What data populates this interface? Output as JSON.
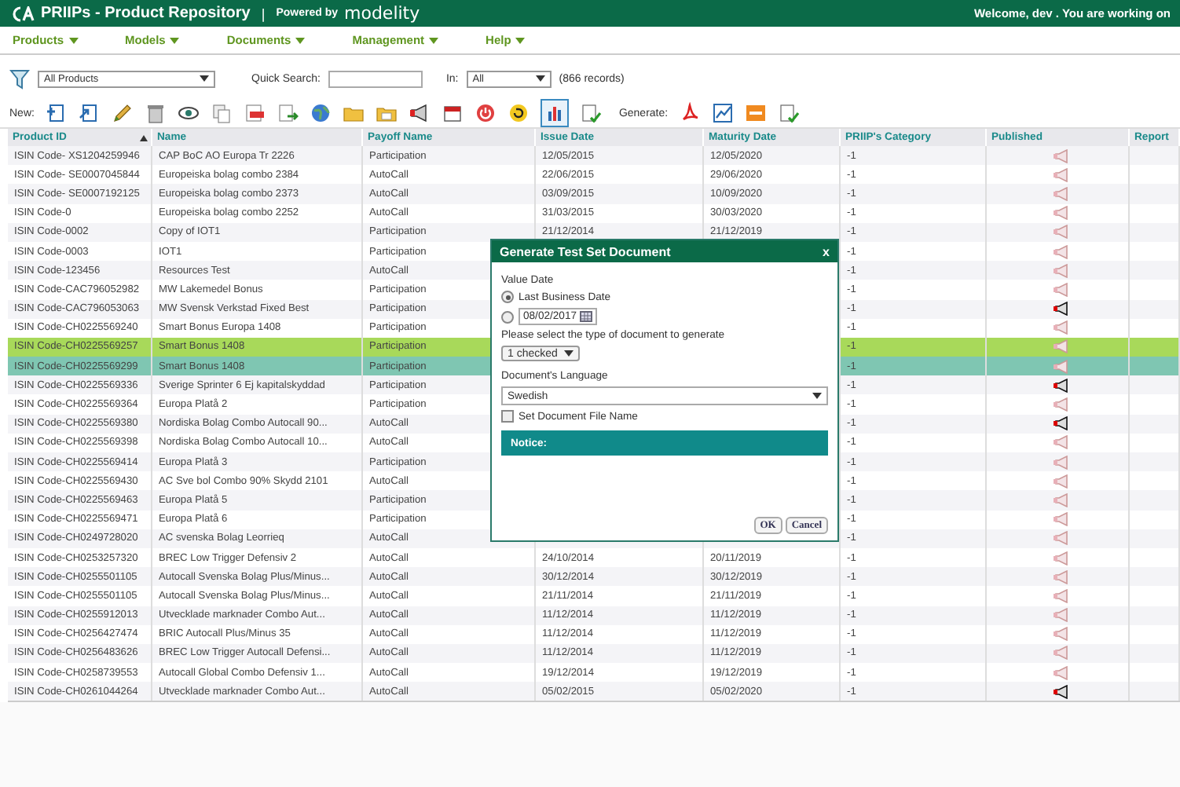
{
  "header": {
    "title": "PRIIPs - Product Repository",
    "separator": "|",
    "powered_by": "Powered by",
    "brand": "modelity",
    "welcome": "Welcome, dev . You are working on"
  },
  "menu": [
    {
      "label": "Products"
    },
    {
      "label": "Models"
    },
    {
      "label": "Documents"
    },
    {
      "label": "Management"
    },
    {
      "label": "Help"
    }
  ],
  "filter": {
    "view": "All Products",
    "quick_search_label": "Quick Search:",
    "in_label": "In:",
    "in_value": "All",
    "records": "(866 records)"
  },
  "toolbar": {
    "new_label": "New:",
    "generate_label": "Generate:",
    "chart_view_selected": true
  },
  "table": {
    "columns": [
      {
        "label": "Product ID",
        "sorted": true
      },
      {
        "label": "Name"
      },
      {
        "label": "Payoff Name"
      },
      {
        "label": "Issue Date"
      },
      {
        "label": "Maturity Date"
      },
      {
        "label": "PRIIP's Category"
      },
      {
        "label": "Published"
      },
      {
        "label": "Report"
      }
    ],
    "rows": [
      {
        "id": "ISIN Code- XS1204259946",
        "name": "CAP BoC AO Europa Tr 2226",
        "payoff": "Participation",
        "issue": "12/05/2015",
        "maturity": "12/05/2020",
        "category": "-1",
        "published": false,
        "selected": false,
        "highlighted": false
      },
      {
        "id": "ISIN Code- SE0007045844",
        "name": "Europeiska bolag combo 2384",
        "payoff": "AutoCall",
        "issue": "22/06/2015",
        "maturity": "29/06/2020",
        "category": "-1",
        "published": false,
        "selected": false,
        "highlighted": false
      },
      {
        "id": "ISIN Code- SE0007192125",
        "name": "Europeiska bolag combo 2373",
        "payoff": "AutoCall",
        "issue": "03/09/2015",
        "maturity": "10/09/2020",
        "category": "-1",
        "published": false,
        "selected": false,
        "highlighted": false
      },
      {
        "id": "ISIN Code-0",
        "name": "Europeiska bolag combo 2252",
        "payoff": "AutoCall",
        "issue": "31/03/2015",
        "maturity": "30/03/2020",
        "category": "-1",
        "published": false,
        "selected": false,
        "highlighted": false
      },
      {
        "id": "ISIN Code-0002",
        "name": "Copy of IOT1",
        "payoff": "Participation",
        "issue": "21/12/2014",
        "maturity": "21/12/2019",
        "category": "-1",
        "published": false,
        "selected": false,
        "highlighted": false
      },
      {
        "id": "ISIN Code-0003",
        "name": "IOT1",
        "payoff": "Participation",
        "category": "-1",
        "published": false,
        "selected": false,
        "highlighted": false
      },
      {
        "id": "ISIN Code-123456",
        "name": "Resources Test",
        "payoff": "AutoCall",
        "category": "-1",
        "published": false,
        "selected": false,
        "highlighted": false
      },
      {
        "id": "ISIN Code-CAC796052982",
        "name": "MW Lakemedel Bonus",
        "payoff": "Participation",
        "category": "-1",
        "published": false,
        "selected": false,
        "highlighted": false
      },
      {
        "id": "ISIN Code-CAC796053063",
        "name": "MW Svensk Verkstad Fixed Best",
        "payoff": "Participation",
        "category": "-1",
        "published": true,
        "selected": false,
        "highlighted": false
      },
      {
        "id": "ISIN Code-CH0225569240",
        "name": "Smart Bonus Europa 1408",
        "payoff": "Participation",
        "category": "-1",
        "published": false,
        "selected": false,
        "highlighted": false
      },
      {
        "id": "ISIN Code-CH0225569257",
        "name": "Smart Bonus 1408",
        "payoff": "Participation",
        "category": "-1",
        "published": false,
        "selected": true,
        "highlighted": false
      },
      {
        "id": "ISIN Code-CH0225569299",
        "name": "Smart Bonus 1408",
        "payoff": "Participation",
        "category": "-1",
        "published": false,
        "selected": false,
        "highlighted": true
      },
      {
        "id": "ISIN Code-CH0225569336",
        "name": "Sverige Sprinter 6 Ej kapitalskyddad",
        "payoff": "Participation",
        "category": "-1",
        "published": true,
        "selected": false,
        "highlighted": false
      },
      {
        "id": "ISIN Code-CH0225569364",
        "name": "Europa Platå 2",
        "payoff": "Participation",
        "category": "-1",
        "published": false,
        "selected": false,
        "highlighted": false
      },
      {
        "id": "ISIN Code-CH0225569380",
        "name": "Nordiska Bolag Combo Autocall 90...",
        "payoff": "AutoCall",
        "category": "-1",
        "published": true,
        "selected": false,
        "highlighted": false
      },
      {
        "id": "ISIN Code-CH0225569398",
        "name": "Nordiska Bolag Combo Autocall 10...",
        "payoff": "AutoCall",
        "category": "-1",
        "published": false,
        "selected": false,
        "highlighted": false
      },
      {
        "id": "ISIN Code-CH0225569414",
        "name": "Europa Platå 3",
        "payoff": "Participation",
        "category": "-1",
        "published": false,
        "selected": false,
        "highlighted": false
      },
      {
        "id": "ISIN Code-CH0225569430",
        "name": "AC Sve bol Combo 90% Skydd 2101",
        "payoff": "AutoCall",
        "category": "-1",
        "published": false,
        "selected": false,
        "highlighted": false
      },
      {
        "id": "ISIN Code-CH0225569463",
        "name": "Europa Platå 5",
        "payoff": "Participation",
        "category": "-1",
        "published": false,
        "selected": false,
        "highlighted": false
      },
      {
        "id": "ISIN Code-CH0225569471",
        "name": "Europa Platå 6",
        "payoff": "Participation",
        "category": "-1",
        "published": false,
        "selected": false,
        "highlighted": false
      },
      {
        "id": "ISIN Code-CH0249728020",
        "name": "AC svenska Bolag Leorrieq",
        "payoff": "AutoCall",
        "category": "-1",
        "published": false,
        "selected": false,
        "highlighted": false
      },
      {
        "id": "ISIN Code-CH0253257320",
        "name": "BREC Low Trigger Defensiv 2",
        "payoff": "AutoCall",
        "issue": "24/10/2014",
        "maturity": "20/11/2019",
        "category": "-1",
        "published": false,
        "selected": false,
        "highlighted": false
      },
      {
        "id": "ISIN Code-CH0255501105",
        "name": "Autocall Svenska Bolag Plus/Minus...",
        "payoff": "AutoCall",
        "issue": "30/12/2014",
        "maturity": "30/12/2019",
        "category": "-1",
        "published": false,
        "selected": false,
        "highlighted": false
      },
      {
        "id": "ISIN Code-CH0255501105",
        "name": "Autocall Svenska Bolag Plus/Minus...",
        "payoff": "AutoCall",
        "issue": "21/11/2014",
        "maturity": "21/11/2019",
        "category": "-1",
        "published": false,
        "selected": false,
        "highlighted": false
      },
      {
        "id": "ISIN Code-CH0255912013",
        "name": "Utvecklade marknader Combo Aut...",
        "payoff": "AutoCall",
        "issue": "11/12/2014",
        "maturity": "11/12/2019",
        "category": "-1",
        "published": false,
        "selected": false,
        "highlighted": false
      },
      {
        "id": "ISIN Code-CH0256427474",
        "name": "BRIC Autocall Plus/Minus 35",
        "payoff": "AutoCall",
        "issue": "11/12/2014",
        "maturity": "11/12/2019",
        "category": "-1",
        "published": false,
        "selected": false,
        "highlighted": false
      },
      {
        "id": "ISIN Code-CH0256483626",
        "name": "BREC Low Trigger Autocall Defensi...",
        "payoff": "AutoCall",
        "issue": "11/12/2014",
        "maturity": "11/12/2019",
        "category": "-1",
        "published": false,
        "selected": false,
        "highlighted": false
      },
      {
        "id": "ISIN Code-CH0258739553",
        "name": "Autocall Global Combo Defensiv 1...",
        "payoff": "AutoCall",
        "issue": "19/12/2014",
        "maturity": "19/12/2019",
        "category": "-1",
        "published": false,
        "selected": false,
        "highlighted": false
      },
      {
        "id": "ISIN Code-CH0261044264",
        "name": "Utvecklade marknader Combo Aut...",
        "payoff": "AutoCall",
        "issue": "05/02/2015",
        "maturity": "05/02/2020",
        "category": "-1",
        "published": true,
        "selected": false,
        "highlighted": false
      }
    ]
  },
  "dialog": {
    "title": "Generate Test Set Document",
    "close": "x",
    "value_date_label": "Value Date",
    "options": [
      {
        "kind": "label",
        "label": "Last Business Date",
        "selected": true
      },
      {
        "kind": "date",
        "value": "08/02/2017",
        "selected": false
      }
    ],
    "doc_type_label": "Please select the type of document to generate",
    "doc_type_value": "1 checked",
    "language_label": "Document's Language",
    "language": "Swedish",
    "file_name": {
      "label": "Set Document File Name",
      "checked": false
    },
    "notice": "Notice:",
    "buttons": [
      "OK",
      "Cancel"
    ]
  }
}
